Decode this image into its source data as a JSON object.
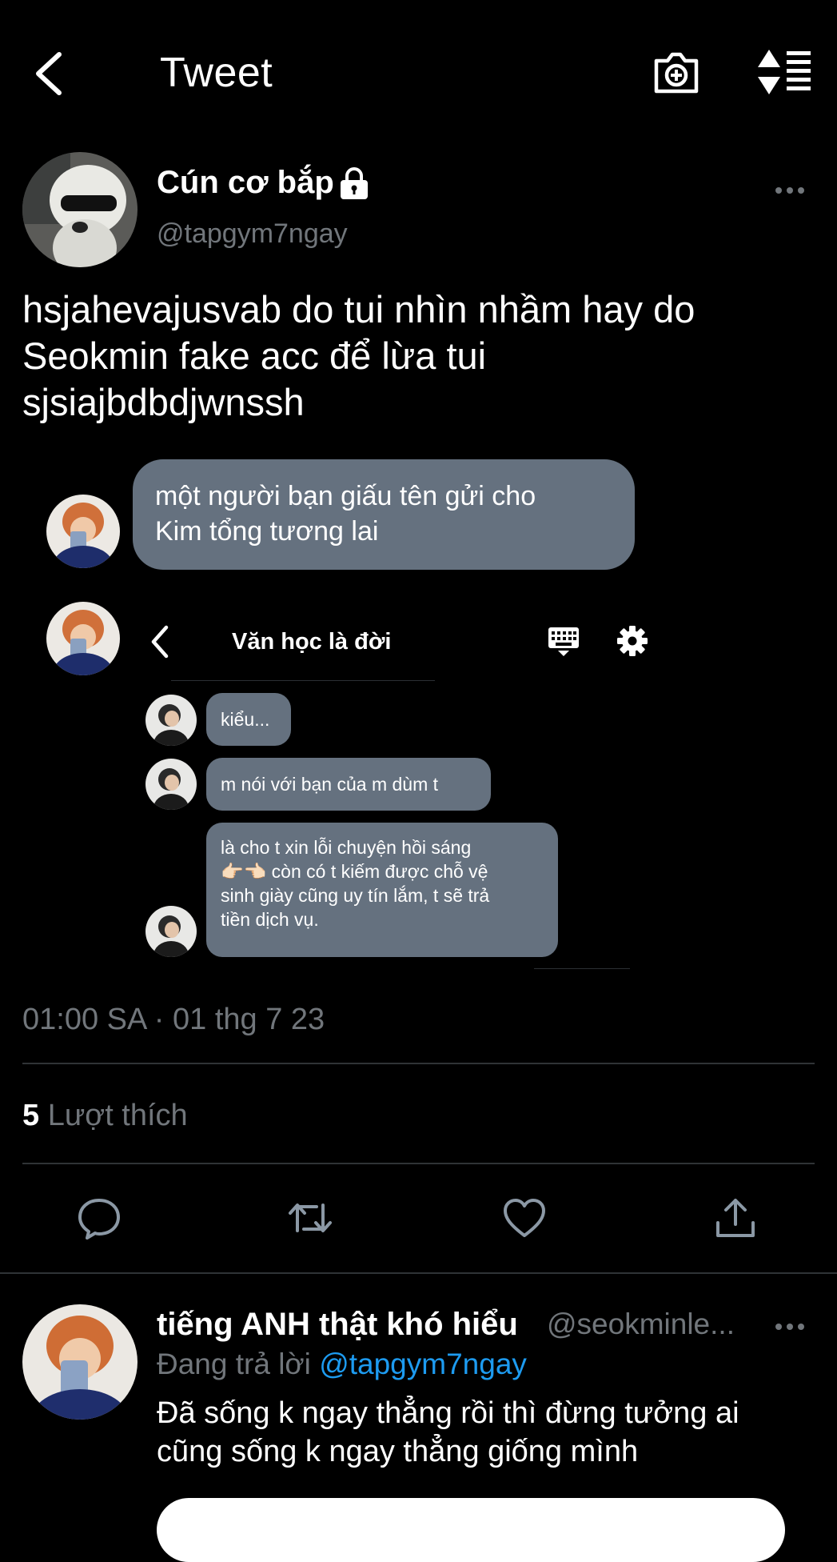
{
  "header": {
    "title": "Tweet",
    "icons": [
      "back-icon",
      "camera-icon",
      "sort-icon"
    ]
  },
  "author": {
    "name": "Cún cơ bắp",
    "handle": "@tapgym7ngay",
    "protected": true
  },
  "tweet": {
    "text": "hsjahevajusvab do tui nhìn nhầm hay do\nSeokmin fake acc để lừa tui\nsjsiajbdbdjwnssh"
  },
  "media": {
    "first_message": "một người bạn giấu tên gửi cho\nKim tổng tương lai",
    "chat": {
      "title": "Văn học là đời",
      "messages": [
        "kiểu...",
        "m nói với bạn của m dùm t",
        "là cho t xin lỗi chuyện hồi sáng\n👉🏻👈🏻 còn có t kiếm được chỗ vệ\nsinh giày cũng uy tín lắm, t sẽ trả\ntiền dịch vụ."
      ]
    }
  },
  "meta": {
    "timestamp": "01:00 SA · 01 thg 7 23",
    "likes_count": "5",
    "likes_label": "Lượt thích"
  },
  "reply": {
    "name": "tiếng ANH thật khó hiểu",
    "handle": "@seokminle...",
    "replying_prefix": "Đang trả lời ",
    "replying_to": "@tapgym7ngay",
    "text": "Đã sống k ngay thẳng rồi thì đừng tưởng ai\ncũng sống k ngay thẳng giống mình"
  },
  "colors": {
    "background": "#000000",
    "secondary_text": "#71767b",
    "link": "#1d9bf0",
    "bubble": "#65717f"
  }
}
